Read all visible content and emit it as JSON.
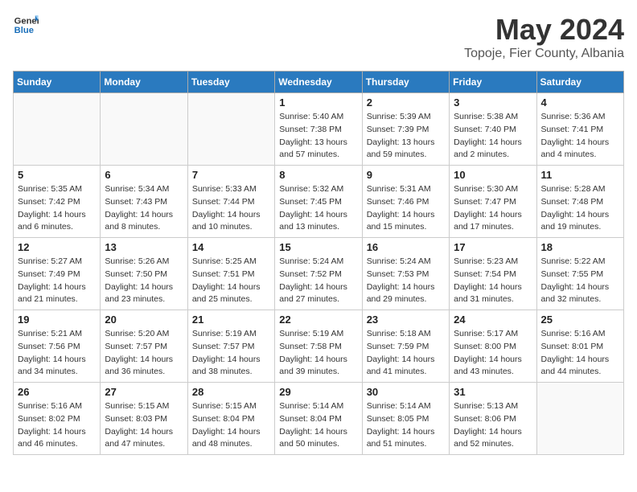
{
  "header": {
    "logo_general": "General",
    "logo_blue": "Blue",
    "month_title": "May 2024",
    "location": "Topoje, Fier County, Albania"
  },
  "weekdays": [
    "Sunday",
    "Monday",
    "Tuesday",
    "Wednesday",
    "Thursday",
    "Friday",
    "Saturday"
  ],
  "weeks": [
    [
      {
        "day": "",
        "info": ""
      },
      {
        "day": "",
        "info": ""
      },
      {
        "day": "",
        "info": ""
      },
      {
        "day": "1",
        "info": "Sunrise: 5:40 AM\nSunset: 7:38 PM\nDaylight: 13 hours\nand 57 minutes."
      },
      {
        "day": "2",
        "info": "Sunrise: 5:39 AM\nSunset: 7:39 PM\nDaylight: 13 hours\nand 59 minutes."
      },
      {
        "day": "3",
        "info": "Sunrise: 5:38 AM\nSunset: 7:40 PM\nDaylight: 14 hours\nand 2 minutes."
      },
      {
        "day": "4",
        "info": "Sunrise: 5:36 AM\nSunset: 7:41 PM\nDaylight: 14 hours\nand 4 minutes."
      }
    ],
    [
      {
        "day": "5",
        "info": "Sunrise: 5:35 AM\nSunset: 7:42 PM\nDaylight: 14 hours\nand 6 minutes."
      },
      {
        "day": "6",
        "info": "Sunrise: 5:34 AM\nSunset: 7:43 PM\nDaylight: 14 hours\nand 8 minutes."
      },
      {
        "day": "7",
        "info": "Sunrise: 5:33 AM\nSunset: 7:44 PM\nDaylight: 14 hours\nand 10 minutes."
      },
      {
        "day": "8",
        "info": "Sunrise: 5:32 AM\nSunset: 7:45 PM\nDaylight: 14 hours\nand 13 minutes."
      },
      {
        "day": "9",
        "info": "Sunrise: 5:31 AM\nSunset: 7:46 PM\nDaylight: 14 hours\nand 15 minutes."
      },
      {
        "day": "10",
        "info": "Sunrise: 5:30 AM\nSunset: 7:47 PM\nDaylight: 14 hours\nand 17 minutes."
      },
      {
        "day": "11",
        "info": "Sunrise: 5:28 AM\nSunset: 7:48 PM\nDaylight: 14 hours\nand 19 minutes."
      }
    ],
    [
      {
        "day": "12",
        "info": "Sunrise: 5:27 AM\nSunset: 7:49 PM\nDaylight: 14 hours\nand 21 minutes."
      },
      {
        "day": "13",
        "info": "Sunrise: 5:26 AM\nSunset: 7:50 PM\nDaylight: 14 hours\nand 23 minutes."
      },
      {
        "day": "14",
        "info": "Sunrise: 5:25 AM\nSunset: 7:51 PM\nDaylight: 14 hours\nand 25 minutes."
      },
      {
        "day": "15",
        "info": "Sunrise: 5:24 AM\nSunset: 7:52 PM\nDaylight: 14 hours\nand 27 minutes."
      },
      {
        "day": "16",
        "info": "Sunrise: 5:24 AM\nSunset: 7:53 PM\nDaylight: 14 hours\nand 29 minutes."
      },
      {
        "day": "17",
        "info": "Sunrise: 5:23 AM\nSunset: 7:54 PM\nDaylight: 14 hours\nand 31 minutes."
      },
      {
        "day": "18",
        "info": "Sunrise: 5:22 AM\nSunset: 7:55 PM\nDaylight: 14 hours\nand 32 minutes."
      }
    ],
    [
      {
        "day": "19",
        "info": "Sunrise: 5:21 AM\nSunset: 7:56 PM\nDaylight: 14 hours\nand 34 minutes."
      },
      {
        "day": "20",
        "info": "Sunrise: 5:20 AM\nSunset: 7:57 PM\nDaylight: 14 hours\nand 36 minutes."
      },
      {
        "day": "21",
        "info": "Sunrise: 5:19 AM\nSunset: 7:57 PM\nDaylight: 14 hours\nand 38 minutes."
      },
      {
        "day": "22",
        "info": "Sunrise: 5:19 AM\nSunset: 7:58 PM\nDaylight: 14 hours\nand 39 minutes."
      },
      {
        "day": "23",
        "info": "Sunrise: 5:18 AM\nSunset: 7:59 PM\nDaylight: 14 hours\nand 41 minutes."
      },
      {
        "day": "24",
        "info": "Sunrise: 5:17 AM\nSunset: 8:00 PM\nDaylight: 14 hours\nand 43 minutes."
      },
      {
        "day": "25",
        "info": "Sunrise: 5:16 AM\nSunset: 8:01 PM\nDaylight: 14 hours\nand 44 minutes."
      }
    ],
    [
      {
        "day": "26",
        "info": "Sunrise: 5:16 AM\nSunset: 8:02 PM\nDaylight: 14 hours\nand 46 minutes."
      },
      {
        "day": "27",
        "info": "Sunrise: 5:15 AM\nSunset: 8:03 PM\nDaylight: 14 hours\nand 47 minutes."
      },
      {
        "day": "28",
        "info": "Sunrise: 5:15 AM\nSunset: 8:04 PM\nDaylight: 14 hours\nand 48 minutes."
      },
      {
        "day": "29",
        "info": "Sunrise: 5:14 AM\nSunset: 8:04 PM\nDaylight: 14 hours\nand 50 minutes."
      },
      {
        "day": "30",
        "info": "Sunrise: 5:14 AM\nSunset: 8:05 PM\nDaylight: 14 hours\nand 51 minutes."
      },
      {
        "day": "31",
        "info": "Sunrise: 5:13 AM\nSunset: 8:06 PM\nDaylight: 14 hours\nand 52 minutes."
      },
      {
        "day": "",
        "info": ""
      }
    ]
  ]
}
